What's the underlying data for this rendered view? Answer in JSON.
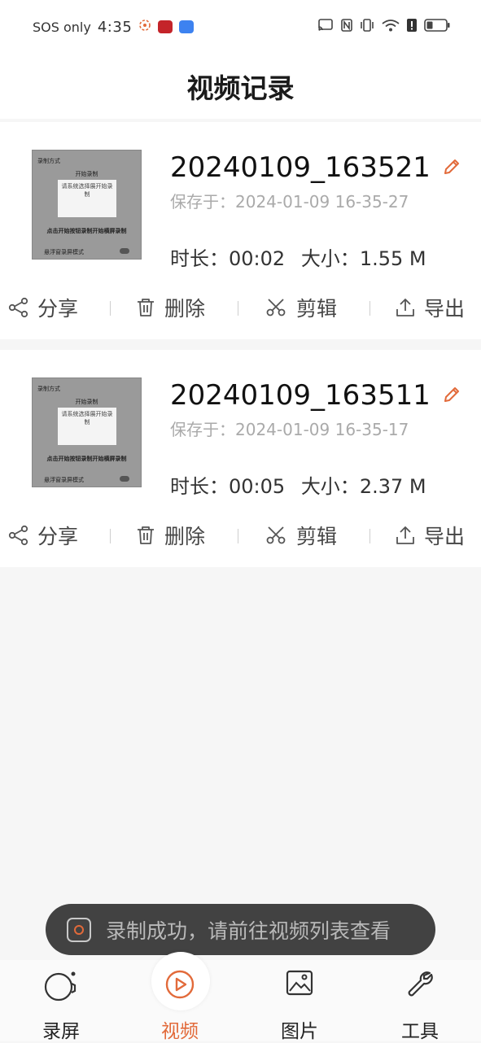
{
  "status_bar": {
    "carrier": "SOS only",
    "time": "4:35"
  },
  "header": {
    "title": "视频记录"
  },
  "thumbnail_text": {
    "head": "录制方式",
    "sub": "开始录制",
    "box": "请系统选择展开始录制",
    "line": "点击开始按钮录制开始横屏录制",
    "foot": "悬浮窗录屏模式"
  },
  "videos": [
    {
      "name": "20240109_163521",
      "saved_label": "保存于：",
      "saved_at": "2024-01-09 16-35-27",
      "duration_label": "时长：",
      "duration": "00:02",
      "size_label": "大小：",
      "size": "1.55 M"
    },
    {
      "name": "20240109_163511",
      "saved_label": "保存于：",
      "saved_at": "2024-01-09 16-35-17",
      "duration_label": "时长：",
      "duration": "00:05",
      "size_label": "大小：",
      "size": "2.37 M"
    }
  ],
  "actions": {
    "share": "分享",
    "delete": "删除",
    "edit": "剪辑",
    "export": "导出"
  },
  "toast": {
    "text": "录制成功，请前往视频列表查看"
  },
  "bottom_nav": {
    "record": "录屏",
    "video": "视频",
    "image": "图片",
    "tools": "工具"
  },
  "colors": {
    "accent": "#e26a3a",
    "toast_bg": "#424242"
  }
}
